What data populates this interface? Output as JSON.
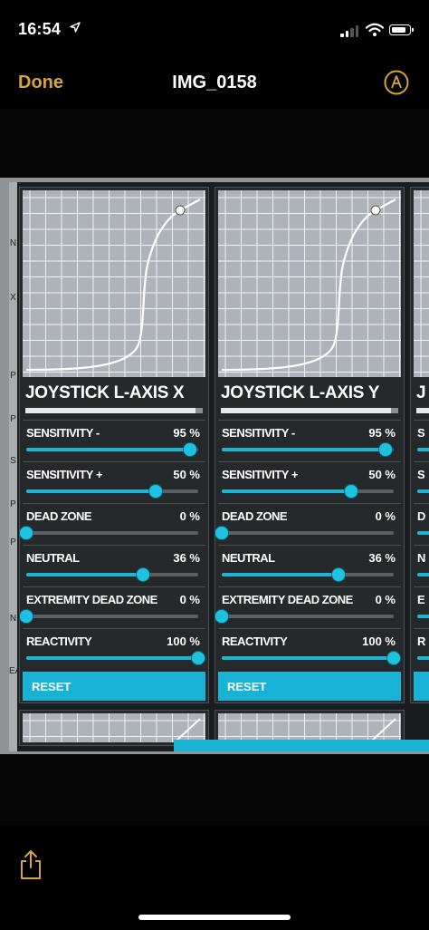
{
  "status_bar": {
    "time": "16:54",
    "location_icon": "location-arrow-icon",
    "signal_icon": "cellular-signal-icon",
    "wifi_icon": "wifi-icon",
    "battery_icon": "battery-icon"
  },
  "nav": {
    "done_label": "Done",
    "title": "IMG_0158",
    "markup_icon": "markup-pen-icon"
  },
  "photo": {
    "side_letters": [
      "N",
      "X",
      "P",
      "P",
      "S",
      "P",
      "P",
      "N",
      "EA"
    ],
    "panels": [
      {
        "title": "JOYSTICK L-AXIS X",
        "settings": [
          {
            "label": "SENSITIVITY -",
            "value_text": "95 %",
            "level": 0.95
          },
          {
            "label": "SENSITIVITY +",
            "value_text": "50 %",
            "level": 0.75
          },
          {
            "label": "DEAD ZONE",
            "value_text": "0 %",
            "level": 0.0
          },
          {
            "label": "NEUTRAL",
            "value_text": "36 %",
            "level": 0.68
          },
          {
            "label": "EXTREMITY DEAD ZONE",
            "value_text": "0 %",
            "level": 0.0
          },
          {
            "label": "REACTIVITY",
            "value_text": "100 %",
            "level": 1.0
          }
        ],
        "reset_label": "RESET"
      },
      {
        "title": "JOYSTICK L-AXIS Y",
        "settings": [
          {
            "label": "SENSITIVITY -",
            "value_text": "95 %",
            "level": 0.95
          },
          {
            "label": "SENSITIVITY +",
            "value_text": "50 %",
            "level": 0.75
          },
          {
            "label": "DEAD ZONE",
            "value_text": "0 %",
            "level": 0.0
          },
          {
            "label": "NEUTRAL",
            "value_text": "36 %",
            "level": 0.68
          },
          {
            "label": "EXTREMITY DEAD ZONE",
            "value_text": "0 %",
            "level": 0.0
          },
          {
            "label": "REACTIVITY",
            "value_text": "100 %",
            "level": 1.0
          }
        ],
        "reset_label": "RESET"
      }
    ],
    "partial_panel": {
      "title": "J",
      "labels": [
        "S",
        "S",
        "D",
        "N",
        "E",
        "R"
      ]
    }
  },
  "toolbar": {
    "share_icon": "share-icon"
  },
  "colors": {
    "accent": "#1fb4d2",
    "done": "#d4a63a",
    "panel_bg": "#26292c",
    "graph_bg": "#adb3b8"
  }
}
